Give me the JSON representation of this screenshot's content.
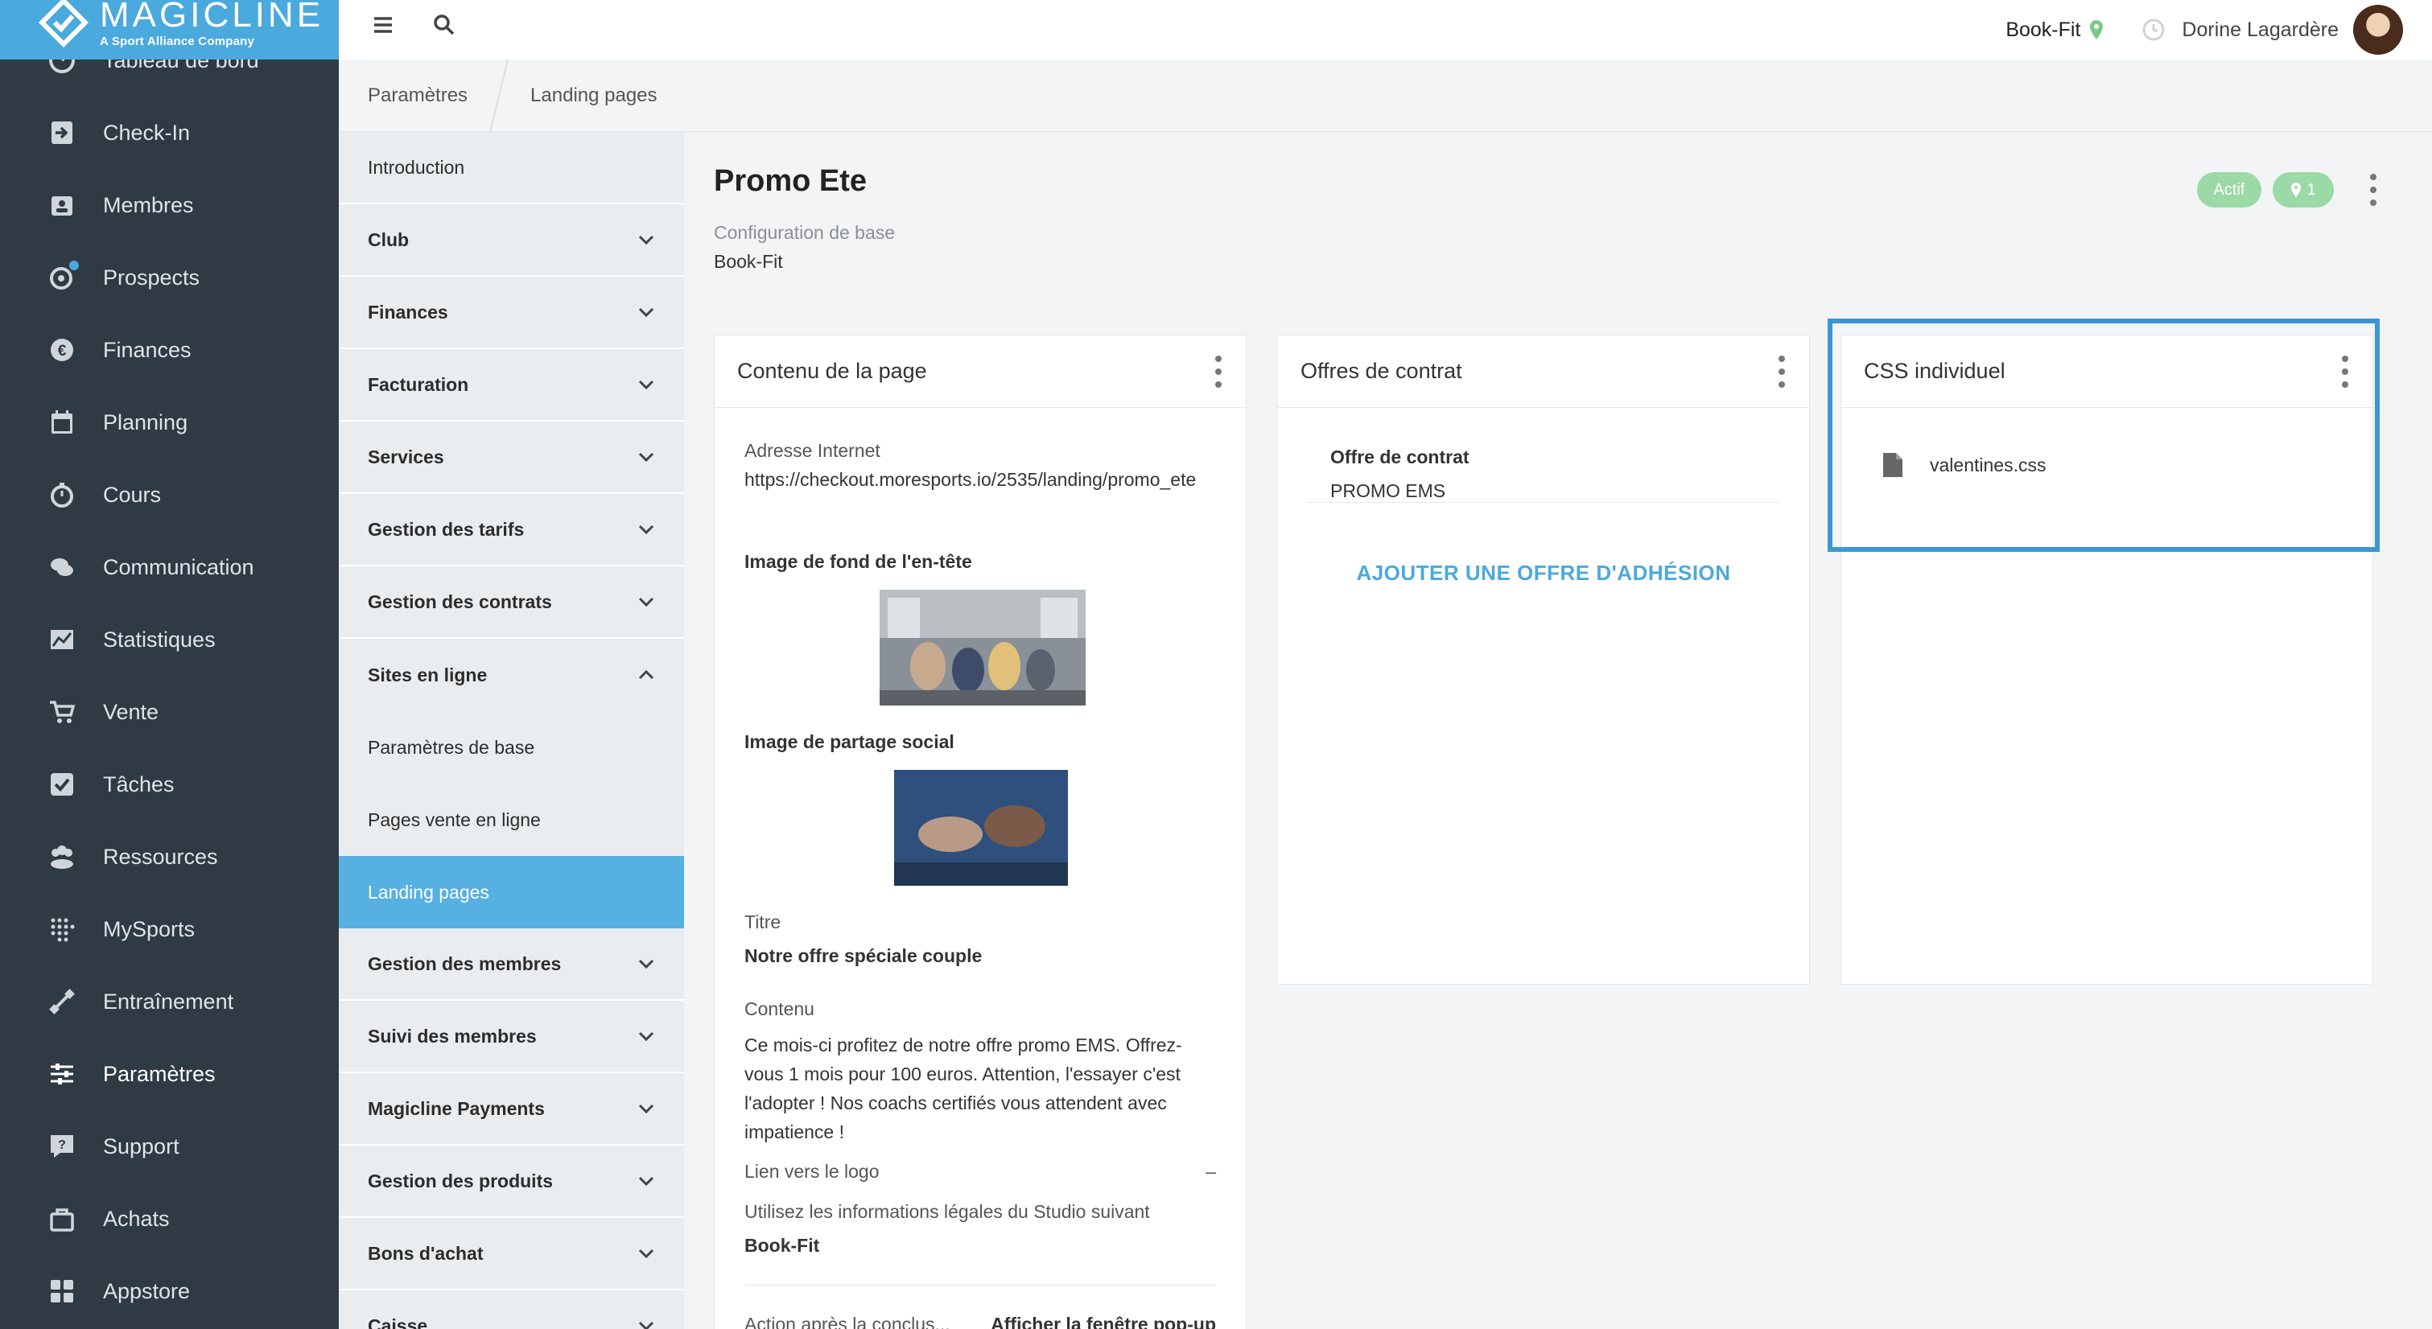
{
  "brand": {
    "name": "MAGICLINE",
    "tagline": "A Sport Alliance Company"
  },
  "nav": {
    "items": [
      {
        "label": "Tableau de bord",
        "icon": "dashboard-icon"
      },
      {
        "label": "Check-In",
        "icon": "checkin-icon"
      },
      {
        "label": "Membres",
        "icon": "members-icon"
      },
      {
        "label": "Prospects",
        "icon": "prospects-icon"
      },
      {
        "label": "Finances",
        "icon": "euro-icon"
      },
      {
        "label": "Planning",
        "icon": "calendar-icon"
      },
      {
        "label": "Cours",
        "icon": "stopwatch-icon"
      },
      {
        "label": "Communication",
        "icon": "chat-icon"
      },
      {
        "label": "Statistiques",
        "icon": "chart-icon"
      },
      {
        "label": "Vente",
        "icon": "cart-icon"
      },
      {
        "label": "Tâches",
        "icon": "checkbox-icon"
      },
      {
        "label": "Ressources",
        "icon": "resources-icon"
      },
      {
        "label": "MySports",
        "icon": "mysports-icon"
      },
      {
        "label": "Entraînement",
        "icon": "dumbbell-icon"
      },
      {
        "label": "Paramètres",
        "icon": "sliders-icon"
      },
      {
        "label": "Support",
        "icon": "support-icon"
      },
      {
        "label": "Achats",
        "icon": "bag-icon"
      },
      {
        "label": "Appstore",
        "icon": "apps-icon"
      }
    ]
  },
  "topbar": {
    "club": "Book-Fit",
    "user": "Dorine Lagardère"
  },
  "breadcrumb": [
    "Paramètres",
    "Landing pages"
  ],
  "settings": {
    "items": [
      {
        "label": "Introduction"
      },
      {
        "label": "Club"
      },
      {
        "label": "Finances"
      },
      {
        "label": "Facturation"
      },
      {
        "label": "Services"
      },
      {
        "label": "Gestion des tarifs"
      },
      {
        "label": "Gestion des contrats"
      },
      {
        "label": "Sites en ligne"
      },
      {
        "label": "Paramètres de base"
      },
      {
        "label": "Pages vente en ligne"
      },
      {
        "label": "Landing pages"
      },
      {
        "label": "Gestion des membres"
      },
      {
        "label": "Suivi des membres"
      },
      {
        "label": "Magicline Payments"
      },
      {
        "label": "Gestion des produits"
      },
      {
        "label": "Bons d'achat"
      },
      {
        "label": "Caisse"
      }
    ]
  },
  "page": {
    "title": "Promo Ete",
    "subtitle": "Configuration de base",
    "subvalue": "Book-Fit",
    "status_badge": "Actif",
    "location_badge": "1"
  },
  "content_card": {
    "title": "Contenu de la page",
    "url_label": "Adresse Internet",
    "url_value": "https://checkout.moresports.io/2535/landing/promo_ete",
    "header_image_label": "Image de fond de l'en-tête",
    "social_image_label": "Image de partage social",
    "titre_label": "Titre",
    "titre_value": "Notre offre spéciale couple",
    "contenu_label": "Contenu",
    "contenu_value": "Ce mois-ci profitez de notre offre promo EMS. Offrez-vous 1 mois pour 100 euros. Attention, l'essayer c'est l'adopter ! Nos coachs certifiés vous attendent avec impatience !",
    "logo_label": "Lien vers le logo",
    "logo_value": "–",
    "legal_label": "Utilisez les informations légales du Studio suivant",
    "legal_value": "Book-Fit",
    "action_label": "Action après la conclus...",
    "action_value": "Afficher la fenêtre pop-up"
  },
  "offers_card": {
    "title": "Offres de contrat",
    "offer_label": "Offre de contrat",
    "offer_value": "PROMO EMS",
    "add_link": "AJOUTER UNE OFFRE D'ADHÉSION"
  },
  "css_card": {
    "title": "CSS individuel",
    "file": "valentines.css"
  },
  "colors": {
    "sidebar": "#2f3a45",
    "accent": "#4aa9dd",
    "success": "#9bd9a6",
    "highlight": "#3b97d3"
  }
}
